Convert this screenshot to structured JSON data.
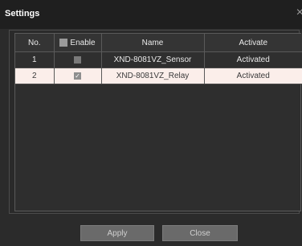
{
  "dialog": {
    "title": "Settings",
    "close_glyph": "×"
  },
  "table": {
    "columns": [
      "No.",
      "Enable",
      "Name",
      "Activate"
    ],
    "rows": [
      {
        "no": "1",
        "enabled": false,
        "name": "XND-8081VZ_Sensor",
        "activate": "Activated"
      },
      {
        "no": "2",
        "enabled": true,
        "name": "XND-8081VZ_Relay",
        "activate": "Activated"
      }
    ]
  },
  "buttons": {
    "apply": "Apply",
    "close": "Close"
  },
  "colors": {
    "selected_row": "#fbeeea",
    "background": "#2b2b2b"
  }
}
